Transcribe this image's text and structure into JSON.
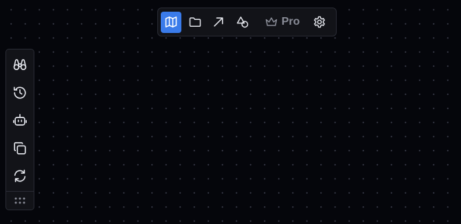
{
  "toolbar": {
    "items": [
      {
        "icon": "map-icon",
        "active": true
      },
      {
        "icon": "folder-icon",
        "active": false
      },
      {
        "icon": "arrow-up-right-icon",
        "active": false
      },
      {
        "icon": "shapes-icon",
        "active": false
      }
    ],
    "pro_label": "Pro",
    "pro_icon": "crown-icon",
    "settings_icon": "gear-icon",
    "accent_color": "#3a7bea"
  },
  "sidebar": {
    "items": [
      {
        "icon": "binoculars-icon"
      },
      {
        "icon": "history-icon"
      },
      {
        "icon": "robot-icon"
      },
      {
        "icon": "copy-icon"
      },
      {
        "icon": "refresh-icon"
      }
    ],
    "grip_icon": "grip-dots-icon"
  },
  "canvas": {
    "background": "#05060b",
    "dot_color": "#3a3d4a"
  }
}
